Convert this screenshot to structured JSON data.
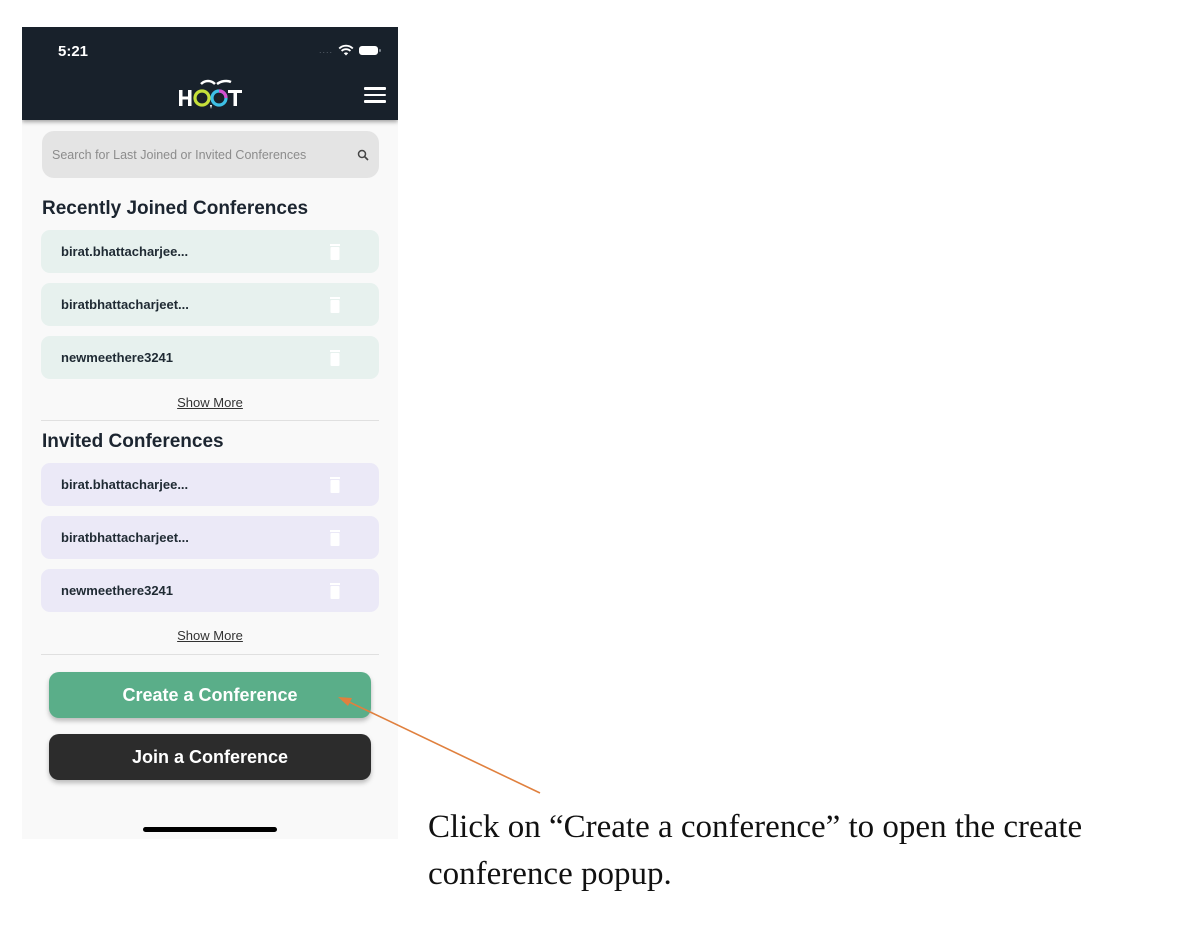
{
  "status_bar": {
    "time": "5:21",
    "signal": "....",
    "wifi_icon": "wifi-icon",
    "battery_icon": "battery-icon"
  },
  "header": {
    "logo_text": "HOOT",
    "menu_icon": "hamburger-menu-icon"
  },
  "search": {
    "placeholder": "Search for Last Joined or Invited Conferences",
    "value": "",
    "icon": "search-icon"
  },
  "recently_joined": {
    "title": "Recently Joined Conferences",
    "items": [
      {
        "label": "birat.bhattacharjee..."
      },
      {
        "label": "biratbhattacharjeet..."
      },
      {
        "label": "newmeethere3241"
      }
    ],
    "show_more": "Show More",
    "color": "#e7f1ee"
  },
  "invited": {
    "title": "Invited Conferences",
    "items": [
      {
        "label": "birat.bhattacharjee..."
      },
      {
        "label": "biratbhattacharjeet..."
      },
      {
        "label": "newmeethere3241"
      }
    ],
    "show_more": "Show More",
    "color": "#ebe9f7"
  },
  "actions": {
    "create_label": "Create a Conference",
    "join_label": "Join a Conference",
    "create_color": "#5aae89",
    "join_color": "#2c2c2c"
  },
  "annotation": {
    "caption": "Click on “Create a conference” to open the create conference popup.",
    "arrow_color": "#e0803e"
  }
}
